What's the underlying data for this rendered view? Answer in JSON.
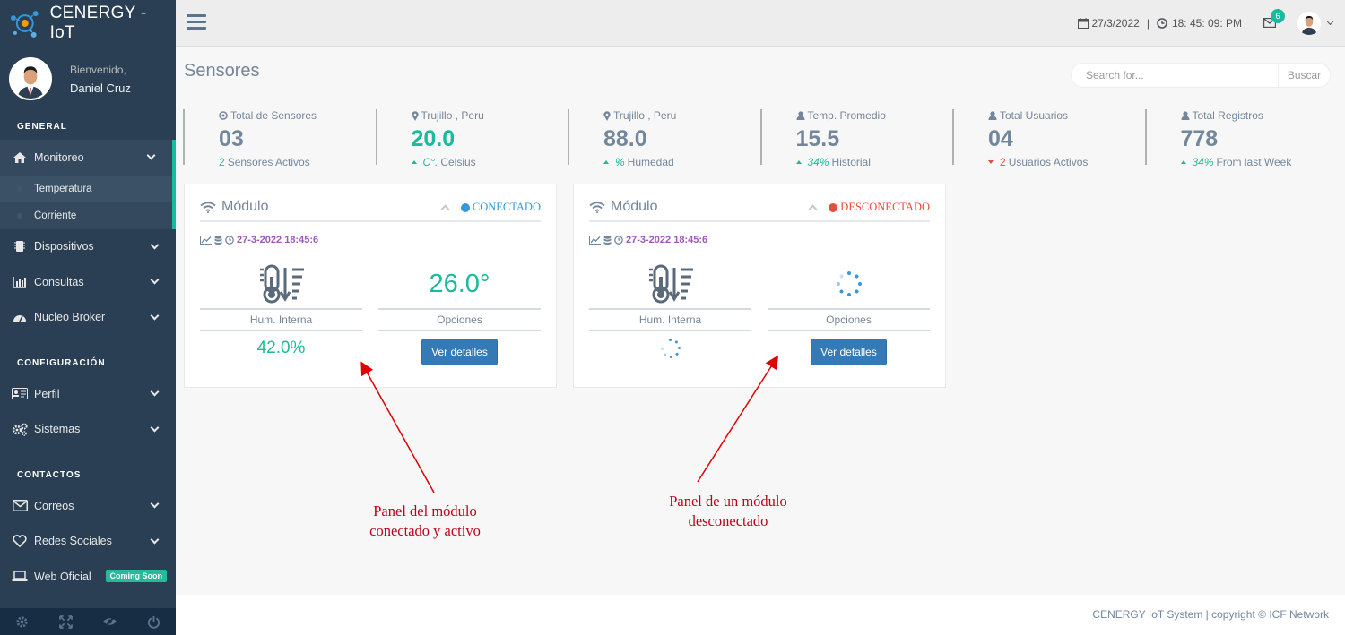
{
  "brand": {
    "name": "CENERGY - IoT"
  },
  "profile": {
    "welcome": "Bienvenido,",
    "name": "Daniel Cruz"
  },
  "sidebar": {
    "sections": [
      "GENERAL",
      "CONFIGURACIÓN",
      "CONTACTOS"
    ],
    "items": [
      {
        "label": "Monitoreo",
        "icon": "home-icon"
      },
      {
        "label": "Temperatura"
      },
      {
        "label": "Corriente"
      },
      {
        "label": "Dispositivos",
        "icon": "chip-icon"
      },
      {
        "label": "Consultas",
        "icon": "bar-chart-icon"
      },
      {
        "label": "Nucleo Broker",
        "icon": "dashboard-icon"
      },
      {
        "label": "Perfil",
        "icon": "id-card-icon"
      },
      {
        "label": "Sistemas",
        "icon": "cogs-icon"
      },
      {
        "label": "Correos",
        "icon": "envelope-icon"
      },
      {
        "label": "Redes Sociales",
        "icon": "heart-icon"
      },
      {
        "label": "Web Oficial",
        "icon": "laptop-icon",
        "badge": "Coming Soon"
      }
    ],
    "footer_icons": [
      "gear-icon",
      "fullscreen-icon",
      "eye-slash-icon",
      "power-icon"
    ]
  },
  "topbar": {
    "date": "27/3/2022",
    "separator": "|",
    "time": "18: 45: 09: PM",
    "mail_count": "6"
  },
  "page": {
    "title": "Sensores"
  },
  "search": {
    "placeholder": "Search for...",
    "button": "Buscar"
  },
  "tiles": [
    {
      "label": "Total de Sensores",
      "value": "03",
      "foot_value": "2",
      "foot_text": "Sensores Activos"
    },
    {
      "label": "Trujillo , Peru",
      "value": "20.0",
      "foot_value": "C°.",
      "foot_text": "Celsius"
    },
    {
      "label": "Trujillo , Peru",
      "value": "88.0",
      "foot_value": "%",
      "foot_text": "Humedad"
    },
    {
      "label": "Temp. Promedio",
      "value": "15.5",
      "foot_value": "34%",
      "foot_text": "Historial"
    },
    {
      "label": "Total Usuarios",
      "value": "04",
      "foot_value": "2",
      "foot_text": "Usuarios Activos"
    },
    {
      "label": "Total Registros",
      "value": "778",
      "foot_value": "34%",
      "foot_text": "From last Week"
    }
  ],
  "panels": [
    {
      "title": "Módulo",
      "status": "CONECTADO",
      "timestamp": "27-3-2022 18:45:6",
      "temperature": "26.0°",
      "hum_label": "Hum. Interna",
      "opt_label": "Opciones",
      "humidity": "42.0%",
      "button": "Ver detalles",
      "status_color": "#3498DB"
    },
    {
      "title": "Módulo",
      "status": "DESCONECTADO",
      "timestamp": "27-3-2022 18:45:6",
      "hum_label": "Hum. Interna",
      "opt_label": "Opciones",
      "button": "Ver detalles",
      "status_color": "#E74C3C"
    }
  ],
  "annotations": {
    "left": [
      "Panel del módulo",
      "conectado y activo"
    ],
    "right": [
      "Panel de un módulo",
      "desconectado"
    ]
  },
  "footer": {
    "text": "CENERGY IoT System | copyright © ICF Network"
  },
  "colors": {
    "sidebar": "#2A3F54",
    "accent": "#1ABB9C",
    "primary": "#337AB7",
    "annotation": "#C0001A"
  }
}
